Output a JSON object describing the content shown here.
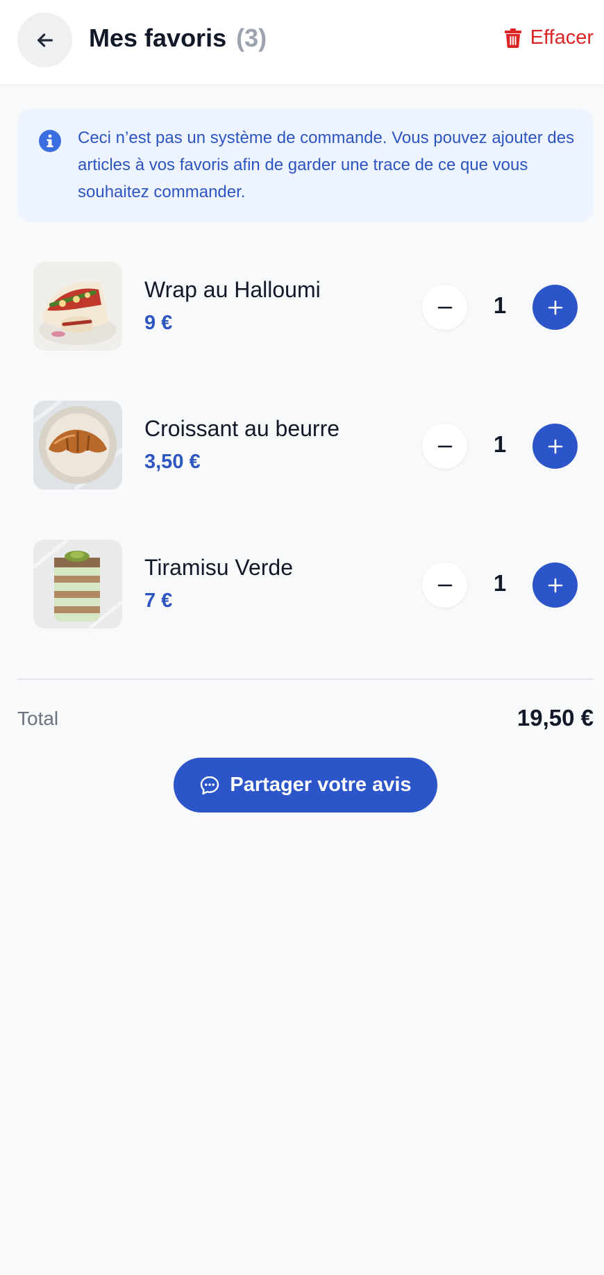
{
  "header": {
    "title": "Mes favoris",
    "count": "(3)",
    "clear_label": "Effacer",
    "back_icon": "arrow-left-icon",
    "clear_icon": "trash-icon"
  },
  "info": {
    "icon": "info-icon",
    "text": "Ceci n’est pas un système de commande. Vous pouvez ajouter des articles à vos favoris afin de garder une trace de ce que vous souhaitez commander."
  },
  "items": [
    {
      "name": "Wrap au Halloumi",
      "price": "9 €",
      "quantity": "1",
      "image": "halloumi-wrap"
    },
    {
      "name": "Croissant au beurre",
      "price": "3,50 €",
      "quantity": "1",
      "image": "croissant"
    },
    {
      "name": "Tiramisu Verde",
      "price": "7 €",
      "quantity": "1",
      "image": "tiramisu"
    }
  ],
  "summary": {
    "total_label": "Total",
    "total_value": "19,50 €"
  },
  "share_button": {
    "label": "Partager votre avis",
    "icon": "chat-icon"
  },
  "colors": {
    "accent": "#2c55c9",
    "danger": "#dc2626",
    "info_bg": "#eef4ff",
    "background": "#f8f9fa"
  }
}
